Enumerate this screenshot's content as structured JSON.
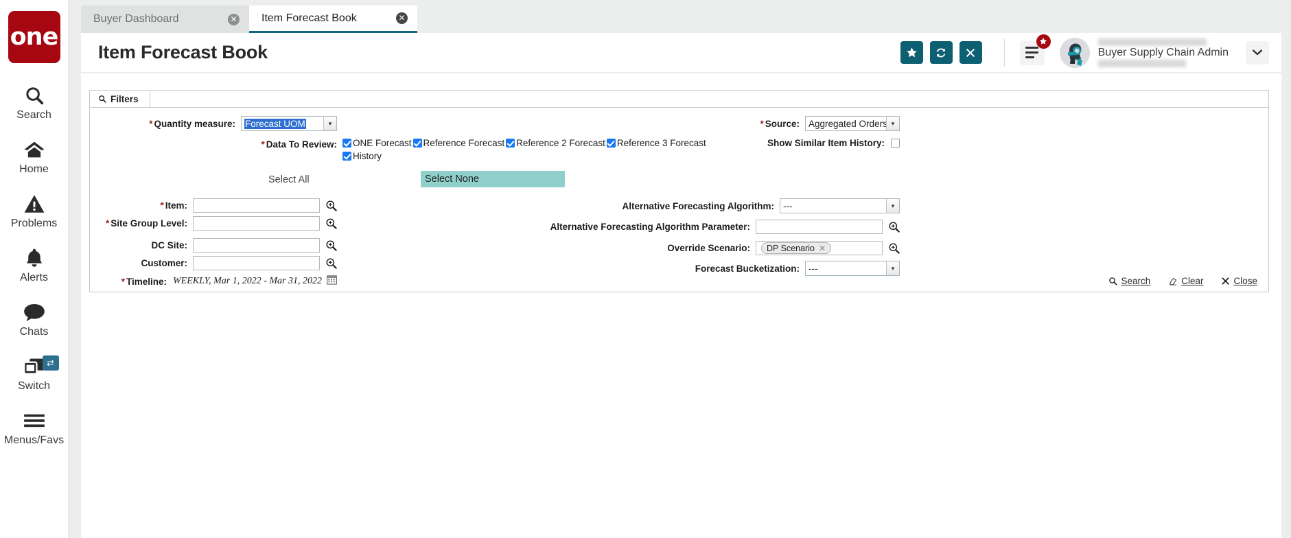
{
  "sidebar": {
    "logo_text": "one",
    "items": [
      {
        "label": "Search",
        "icon": "search-icon"
      },
      {
        "label": "Home",
        "icon": "home-icon"
      },
      {
        "label": "Problems",
        "icon": "warning-triangle-icon"
      },
      {
        "label": "Alerts",
        "icon": "bell-icon"
      },
      {
        "label": "Chats",
        "icon": "chat-bubble-icon"
      },
      {
        "label": "Switch",
        "icon": "windows-switch-icon",
        "badge_icon": "swap-arrows-icon"
      },
      {
        "label": "Menus/Favs",
        "icon": "hamburger-icon"
      }
    ]
  },
  "tabs": [
    {
      "label": "Buyer Dashboard",
      "active": false,
      "close_icon": "close-circle-icon"
    },
    {
      "label": "Item Forecast Book",
      "active": true,
      "close_icon": "close-circle-icon"
    }
  ],
  "header": {
    "title": "Item Forecast Book",
    "actions": [
      {
        "name": "favorite-button",
        "icon": "star-icon"
      },
      {
        "name": "refresh-button",
        "icon": "refresh-icon"
      },
      {
        "name": "close-button",
        "icon": "x-icon"
      }
    ],
    "menu_badge_icon": "star-icon",
    "user_role": "Buyer Supply Chain Admin",
    "caret_icon": "chevron-down-icon"
  },
  "filters": {
    "tab_label": "Filters",
    "tab_icon": "search-icon",
    "quantity_measure": {
      "label": "Quantity measure:",
      "required": true,
      "value": "Forecast UOM",
      "selected_highlight": true
    },
    "source": {
      "label": "Source:",
      "required": true,
      "value": "Aggregated Orders"
    },
    "data_to_review": {
      "label": "Data To Review:",
      "required": true,
      "options": [
        {
          "label": "ONE Forecast",
          "checked": true
        },
        {
          "label": "Reference Forecast",
          "checked": true
        },
        {
          "label": "Reference 2 Forecast",
          "checked": true
        },
        {
          "label": "Reference 3 Forecast",
          "checked": true
        },
        {
          "label": "History",
          "checked": true
        }
      ],
      "select_all_label": "Select All",
      "select_none_label": "Select None"
    },
    "show_similar_item_history": {
      "label": "Show Similar Item History:",
      "checked": false
    },
    "item": {
      "label": "Item:",
      "required": true,
      "value": "",
      "lookup_icon": "magnifier-plus-icon"
    },
    "site_group_level": {
      "label": "Site Group Level:",
      "required": true,
      "value": "",
      "lookup_icon": "magnifier-plus-icon"
    },
    "dc_site": {
      "label": "DC Site:",
      "required": false,
      "value": "",
      "lookup_icon": "magnifier-plus-icon"
    },
    "customer": {
      "label": "Customer:",
      "required": false,
      "value": "",
      "lookup_icon": "magnifier-plus-icon"
    },
    "timeline": {
      "label": "Timeline:",
      "required": true,
      "value": "WEEKLY, Mar 1, 2022 - Mar 31, 2022",
      "calendar_icon": "calendar-icon"
    },
    "alt_forecasting_algorithm": {
      "label": "Alternative Forecasting Algorithm:",
      "value": "---"
    },
    "alt_forecasting_algorithm_parameter": {
      "label": "Alternative Forecasting Algorithm Parameter:",
      "value": "",
      "lookup_icon": "magnifier-plus-icon"
    },
    "override_scenario": {
      "label": "Override Scenario:",
      "chip": "DP Scenario",
      "chip_remove_icon": "x-icon",
      "lookup_icon": "magnifier-plus-icon"
    },
    "forecast_bucketization": {
      "label": "Forecast Bucketization:",
      "value": "---"
    },
    "footer": {
      "search": {
        "label": "Search",
        "icon": "search-icon"
      },
      "clear": {
        "label": "Clear",
        "icon": "eraser-icon"
      },
      "close": {
        "label": "Close",
        "icon": "x-icon"
      }
    }
  },
  "colors": {
    "brand_red": "#a60711",
    "teal_button": "#0d5f72",
    "active_tab_underline": "#0d6a7d",
    "highlight_mint": "#8fd0cb",
    "checkbox_blue": "#1778f2",
    "selection_blue": "#2f6fd0",
    "required_star": "#a12121"
  }
}
